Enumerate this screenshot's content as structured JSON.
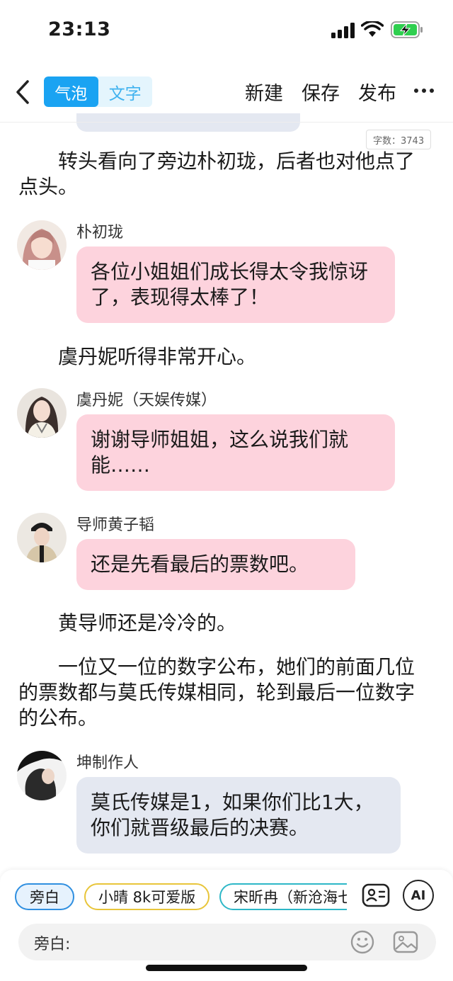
{
  "status_bar": {
    "time": "23:13"
  },
  "nav": {
    "tabs": [
      {
        "label": "气泡",
        "active": true
      },
      {
        "label": "文字",
        "active": false
      }
    ],
    "new_label": "新建",
    "save_label": "保存",
    "publish_label": "发布"
  },
  "word_count": "字数：3743",
  "messages": [
    {
      "kind": "narration",
      "text": "转头看向了旁边朴初珑，后者也对他点了点头。"
    },
    {
      "kind": "character",
      "name": "朴初珑",
      "text": "各位小姐姐们成长得太令我惊讶了，表现得太棒了！",
      "style": "pink"
    },
    {
      "kind": "narration",
      "text": "虞丹妮听得非常开心。"
    },
    {
      "kind": "character",
      "name": "虞丹妮（天娱传媒）",
      "text": "谢谢导师姐姐，这么说我们就能……",
      "style": "pink"
    },
    {
      "kind": "character",
      "name": "导师黄子韬",
      "text": "还是先看最后的票数吧。",
      "style": "pink"
    },
    {
      "kind": "narration",
      "text": "黄导师还是冷冷的。"
    },
    {
      "kind": "narration",
      "text": "一位又一位的数字公布，她们的前面几位的票数都与莫氏传媒相同，轮到最后一位数字的公布。"
    },
    {
      "kind": "character",
      "name": "坤制作人",
      "text": "莫氏传媒是1，如果你们比1大，你们就晋级最后的决赛。",
      "style": "grey"
    }
  ],
  "bottom_bar": {
    "roles": [
      {
        "label": "旁白",
        "color": "#2f8fe0",
        "selected": true
      },
      {
        "label": "小晴 8k可爱版",
        "color": "#e8c53a",
        "selected": false
      },
      {
        "label": "宋昕冉（新沧海七",
        "color": "#2db7c7",
        "selected": false
      }
    ],
    "input_label": "旁白:",
    "ai_label": "AI"
  },
  "colors": {
    "accent": "#1aa3f2",
    "pink_bubble": "#fdd3dd",
    "grey_bubble": "#e4e8f1"
  }
}
